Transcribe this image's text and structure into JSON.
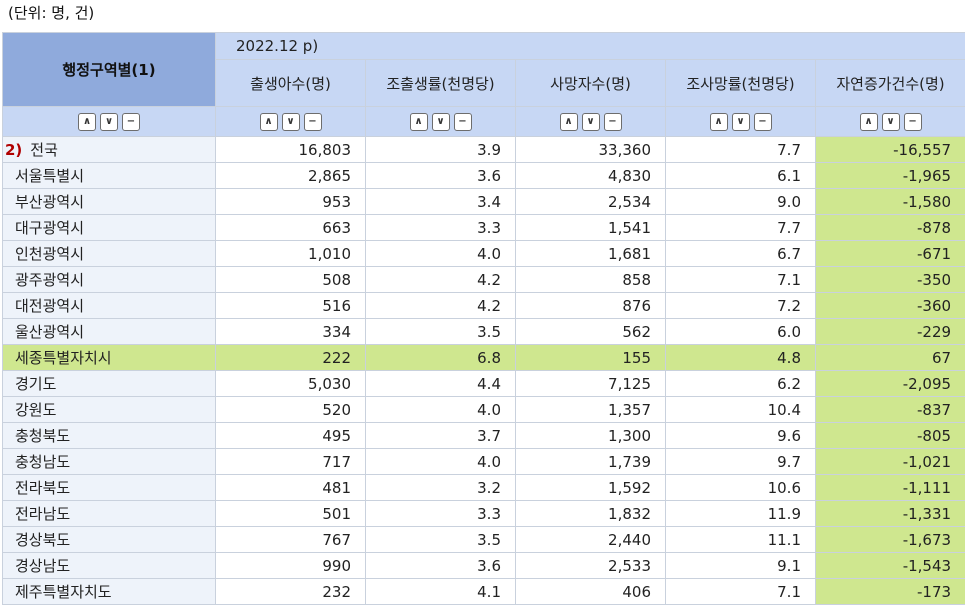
{
  "unit_label": "(단위: 명, 건)",
  "stub_header": "행정구역별(1)",
  "period_label": "2022.12 p)",
  "columns": [
    "출생아수(명)",
    "조출생률(천명당)",
    "사망자수(명)",
    "조사망률(천명당)",
    "자연증가건수(명)"
  ],
  "control_icons": [
    "sort-up-icon",
    "sort-down-icon",
    "remove-icon"
  ],
  "highlight_color": "#cfe78f",
  "rows": [
    {
      "footnote": "2)",
      "name": "전국",
      "values": [
        "16,803",
        "3.9",
        "33,360",
        "7.7",
        "-16,557"
      ]
    },
    {
      "name": "서울특별시",
      "values": [
        "2,865",
        "3.6",
        "4,830",
        "6.1",
        "-1,965"
      ]
    },
    {
      "name": "부산광역시",
      "values": [
        "953",
        "3.4",
        "2,534",
        "9.0",
        "-1,580"
      ]
    },
    {
      "name": "대구광역시",
      "values": [
        "663",
        "3.3",
        "1,541",
        "7.7",
        "-878"
      ]
    },
    {
      "name": "인천광역시",
      "values": [
        "1,010",
        "4.0",
        "1,681",
        "6.7",
        "-671"
      ]
    },
    {
      "name": "광주광역시",
      "values": [
        "508",
        "4.2",
        "858",
        "7.1",
        "-350"
      ]
    },
    {
      "name": "대전광역시",
      "values": [
        "516",
        "4.2",
        "876",
        "7.2",
        "-360"
      ]
    },
    {
      "name": "울산광역시",
      "values": [
        "334",
        "3.5",
        "562",
        "6.0",
        "-229"
      ]
    },
    {
      "name": "세종특별자치시",
      "values": [
        "222",
        "6.8",
        "155",
        "4.8",
        "67"
      ],
      "highlighted": true
    },
    {
      "name": "경기도",
      "values": [
        "5,030",
        "4.4",
        "7,125",
        "6.2",
        "-2,095"
      ]
    },
    {
      "name": "강원도",
      "values": [
        "520",
        "4.0",
        "1,357",
        "10.4",
        "-837"
      ]
    },
    {
      "name": "충청북도",
      "values": [
        "495",
        "3.7",
        "1,300",
        "9.6",
        "-805"
      ]
    },
    {
      "name": "충청남도",
      "values": [
        "717",
        "4.0",
        "1,739",
        "9.7",
        "-1,021"
      ]
    },
    {
      "name": "전라북도",
      "values": [
        "481",
        "3.2",
        "1,592",
        "10.6",
        "-1,111"
      ]
    },
    {
      "name": "전라남도",
      "values": [
        "501",
        "3.3",
        "1,832",
        "11.9",
        "-1,331"
      ]
    },
    {
      "name": "경상북도",
      "values": [
        "767",
        "3.5",
        "2,440",
        "11.1",
        "-1,673"
      ]
    },
    {
      "name": "경상남도",
      "values": [
        "990",
        "3.6",
        "2,533",
        "9.1",
        "-1,543"
      ]
    },
    {
      "name": "제주특별자치도",
      "values": [
        "232",
        "4.1",
        "406",
        "7.1",
        "-173"
      ]
    }
  ]
}
